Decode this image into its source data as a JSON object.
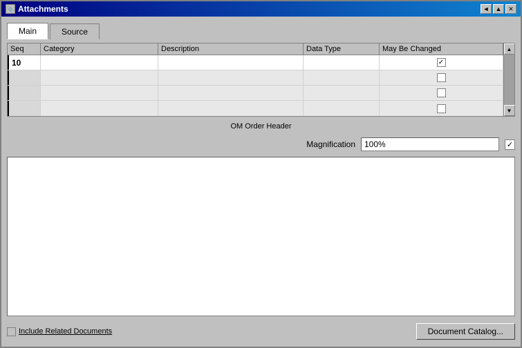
{
  "window": {
    "title": "Attachments",
    "icon": "📎"
  },
  "title_buttons": [
    "◄",
    "▲",
    "✕"
  ],
  "tabs": [
    {
      "id": "main",
      "label": "Main",
      "active": true
    },
    {
      "id": "source",
      "label": "Source",
      "active": false
    }
  ],
  "table": {
    "columns": [
      {
        "id": "seq",
        "label": "Seq"
      },
      {
        "id": "category",
        "label": "Category"
      },
      {
        "id": "description",
        "label": "Description"
      },
      {
        "id": "datatype",
        "label": "Data Type"
      },
      {
        "id": "maychange",
        "label": "May Be Changed"
      }
    ],
    "rows": [
      {
        "seq": "10",
        "category": "",
        "description": "",
        "datatype": "",
        "maychange": true,
        "active": true
      },
      {
        "seq": "",
        "category": "",
        "description": "",
        "datatype": "",
        "maychange": false,
        "active": false
      },
      {
        "seq": "",
        "category": "",
        "description": "",
        "datatype": "",
        "maychange": false,
        "active": false
      },
      {
        "seq": "",
        "category": "",
        "description": "",
        "datatype": "",
        "maychange": false,
        "active": false
      }
    ]
  },
  "entity_label": "OM Order Header",
  "magnification": {
    "label": "Magnification",
    "value": "100%",
    "checkbox_checked": true
  },
  "bottom": {
    "include_label": "Include Related Documents",
    "doc_catalog_btn": "Document Catalog..."
  }
}
